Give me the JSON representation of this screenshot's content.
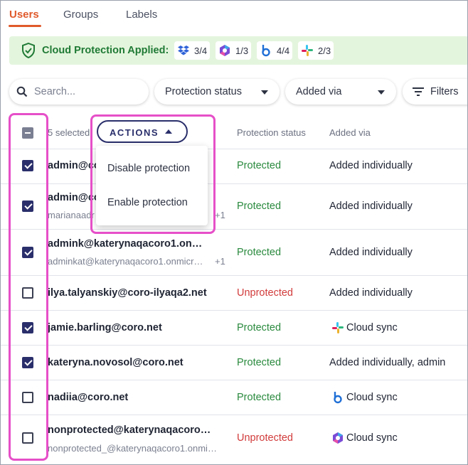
{
  "tabs": [
    {
      "label": "Users",
      "active": true
    },
    {
      "label": "Groups",
      "active": false
    },
    {
      "label": "Labels",
      "active": false
    }
  ],
  "banner": {
    "title": "Cloud Protection Applied:",
    "color": "#1f7a35",
    "services": [
      {
        "icon": "dropbox-icon",
        "count": "3/4"
      },
      {
        "icon": "microsoft-365-icon",
        "count": "1/3"
      },
      {
        "icon": "box-icon",
        "count": "4/4"
      },
      {
        "icon": "slack-icon",
        "count": "2/3"
      }
    ]
  },
  "filters": {
    "search_placeholder": "Search...",
    "protection_status": "Protection status",
    "added_via": "Added via",
    "filters_label": "Filters"
  },
  "table": {
    "selected_count": "5 selected",
    "actions_label": "ACTIONS",
    "columns": {
      "protection_status": "Protection status",
      "added_via": "Added via"
    },
    "menu": [
      "Disable protection",
      "Enable protection"
    ],
    "rows": [
      {
        "email": "admin@co",
        "alias": "",
        "more": "",
        "checked": true,
        "status": "Protected",
        "via": "Added individually",
        "via_icon": ""
      },
      {
        "email": "admin@co",
        "alias": "marianaadr",
        "more": "+1",
        "checked": true,
        "status": "Protected",
        "via": "Added individually",
        "via_icon": ""
      },
      {
        "email": "admink@katerynaqacoro1.on…",
        "alias": "adminkat@katerynaqacoro1.onmicr…",
        "more": "+1",
        "checked": true,
        "status": "Protected",
        "via": "Added individually",
        "via_icon": ""
      },
      {
        "email": "ilya.talyanskiy@coro-ilyaqa2.net",
        "alias": "",
        "more": "",
        "checked": false,
        "status": "Unprotected",
        "via": "Added individually",
        "via_icon": ""
      },
      {
        "email": "jamie.barling@coro.net",
        "alias": "",
        "more": "",
        "checked": true,
        "status": "Protected",
        "via": "Cloud sync",
        "via_icon": "slack-icon"
      },
      {
        "email": "kateryna.novosol@coro.net",
        "alias": "",
        "more": "",
        "checked": true,
        "status": "Protected",
        "via": "Added individually, admin",
        "via_icon": ""
      },
      {
        "email": "nadiia@coro.net",
        "alias": "",
        "more": "",
        "checked": false,
        "status": "Protected",
        "via": "Cloud sync",
        "via_icon": "box-icon"
      },
      {
        "email": "nonprotected@katerynaqacoro…",
        "alias": "nonprotected_@katerynaqacoro1.onmi…",
        "more": "",
        "checked": false,
        "status": "Unprotected",
        "via": "Cloud sync",
        "via_icon": "microsoft-365-icon"
      }
    ]
  },
  "colors": {
    "accent": "#e05a2b",
    "primary": "#2a2f6b",
    "protected": "#2a8a3e",
    "unprotected": "#d23b3b",
    "highlight": "#e64fc8"
  }
}
